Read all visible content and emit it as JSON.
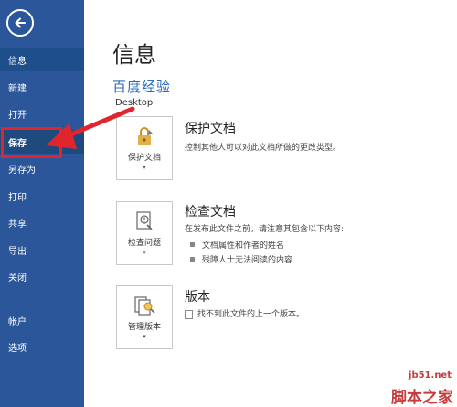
{
  "sidebar": {
    "items": [
      {
        "label": "信息"
      },
      {
        "label": "新建"
      },
      {
        "label": "打开"
      },
      {
        "label": "保存"
      },
      {
        "label": "另存为"
      },
      {
        "label": "打印"
      },
      {
        "label": "共享"
      },
      {
        "label": "导出"
      },
      {
        "label": "关闭"
      },
      {
        "label": "帐户"
      },
      {
        "label": "选项"
      }
    ]
  },
  "main": {
    "title": "信息",
    "watermark_top": "百度经验",
    "location": "Desktop",
    "sections": [
      {
        "tile_label": "保护文档",
        "title": "保护文档",
        "desc": "控制其他人可以对此文档所做的更改类型。"
      },
      {
        "tile_label": "检查问题",
        "title": "检查文档",
        "desc": "在发布此文件之前，请注意其包含以下内容:",
        "bullets": [
          "文档属性和作者的姓名",
          "残障人士无法阅读的内容"
        ]
      },
      {
        "tile_label": "管理版本",
        "title": "版本",
        "desc": "找不到此文件的上一个版本。"
      }
    ]
  },
  "watermark": {
    "site": "jb51.net",
    "name": "脚本之家"
  },
  "colors": {
    "sidebar": "#2b579a",
    "highlight": "#e0262c"
  }
}
